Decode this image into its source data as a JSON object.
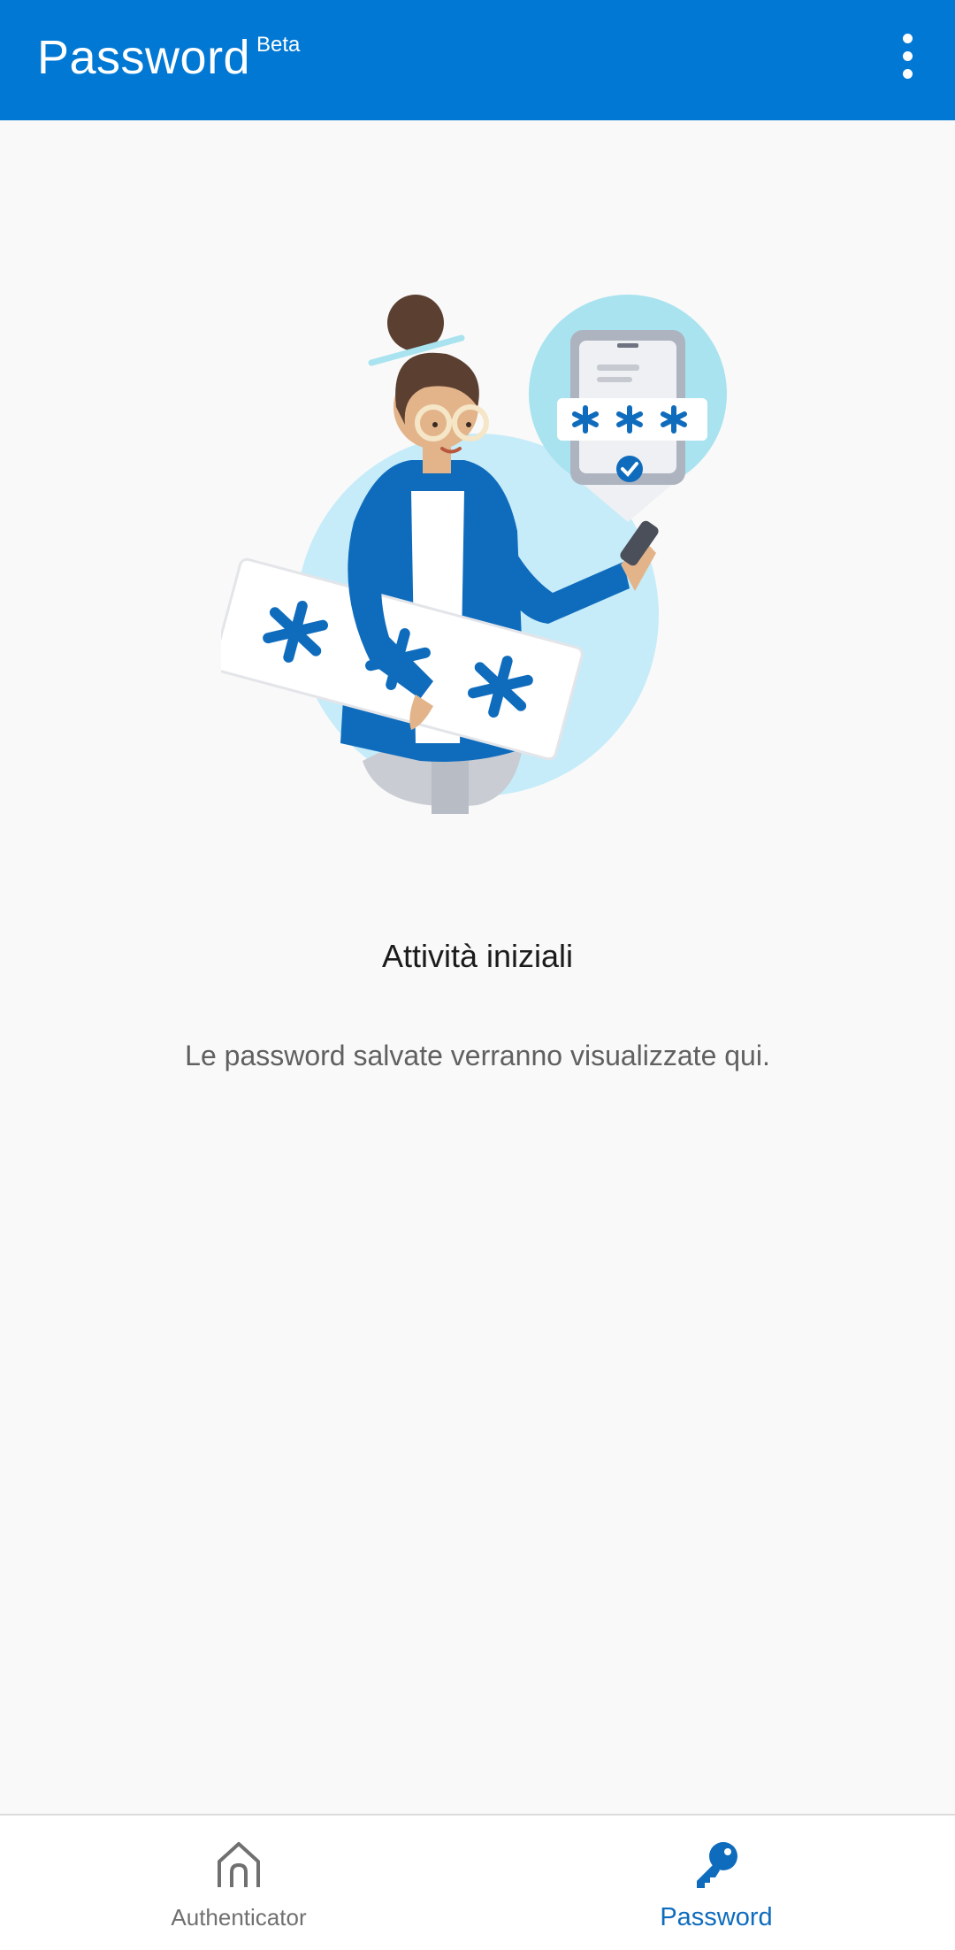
{
  "app_bar": {
    "title": "Password",
    "badge": "Beta",
    "background_color": "#0078d4",
    "menu_icon": "more-vertical-icon"
  },
  "empty_state": {
    "illustration": "woman-holding-password-illustration",
    "heading": "Attività iniziali",
    "message": "Le password salvate verranno visualizzate qui."
  },
  "bottom_nav": {
    "items": [
      {
        "label": "Authenticator",
        "icon": "home-icon",
        "selected": false
      },
      {
        "label": "Password",
        "icon": "key-icon",
        "selected": true
      }
    ],
    "active_color": "#0f6cbd",
    "inactive_color": "#707070"
  }
}
